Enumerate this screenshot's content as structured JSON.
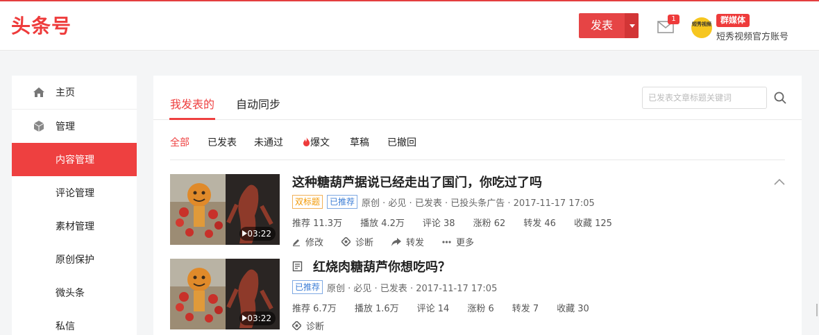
{
  "header": {
    "logo": "头条号",
    "publish_label": "发表",
    "mail_count": "1",
    "avatar_text": "短秀视频",
    "account_badge": "群媒体",
    "account_name": "短秀视频官方账号"
  },
  "sidebar": {
    "items": [
      {
        "label": "主页"
      },
      {
        "label": "管理"
      },
      {
        "label": "内容管理",
        "active": true
      },
      {
        "label": "评论管理"
      },
      {
        "label": "素材管理"
      },
      {
        "label": "原创保护"
      },
      {
        "label": "微头条"
      },
      {
        "label": "私信"
      }
    ]
  },
  "main": {
    "tabs": [
      {
        "label": "我发表的",
        "active": true
      },
      {
        "label": "自动同步"
      }
    ],
    "search": {
      "placeholder": "已发表文章标题关键词"
    },
    "filters": [
      {
        "label": "全部",
        "active": true
      },
      {
        "label": "已发表"
      },
      {
        "label": "未通过"
      },
      {
        "label": "爆文"
      },
      {
        "label": "草稿"
      },
      {
        "label": "已撤回"
      }
    ],
    "articles": [
      {
        "title": "这种糖葫芦据说已经走出了国门，你吃过了吗",
        "duration": "03:22",
        "tags": [
          "双标题",
          "已推荐"
        ],
        "meta": "原创 · 必见 · 已发表 · 已投头条广告 · 2017-11-17 17:05",
        "stats": {
          "recommend": "推荐 11.3万",
          "plays": "播放 4.2万",
          "comments": "评论 38",
          "fans": "涨粉 62",
          "shares": "转发 46",
          "favorites": "收藏 125"
        },
        "actions": {
          "edit": "修改",
          "diagnose": "诊断",
          "forward": "转发",
          "more": "更多"
        }
      },
      {
        "title": "红烧肉糖葫芦你想吃吗？",
        "duration": "03:22",
        "tags": [
          "已推荐"
        ],
        "meta": "原创 · 必见 · 已发表 · 2017-11-17 17:05",
        "stats": {
          "recommend": "推荐 6.7万",
          "plays": "播放 1.6万",
          "comments": "评论 14",
          "fans": "涨粉 6",
          "shares": "转发 7",
          "favorites": "收藏 30"
        },
        "actions": {
          "diagnose": "诊断"
        }
      }
    ]
  },
  "colors": {
    "brand": "#ee3b3b",
    "tag_orange": "#f29700",
    "tag_blue": "#3c7ed6"
  }
}
